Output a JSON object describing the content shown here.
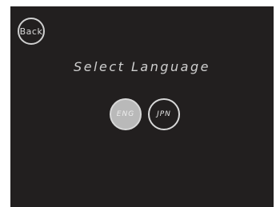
{
  "back_button": {
    "label": "Back"
  },
  "title": "Select Language",
  "languages": [
    {
      "label": "ENG",
      "selected": true
    },
    {
      "label": "JPN",
      "selected": false
    }
  ],
  "colors": {
    "screen_background": "#221f1f",
    "selected_fill": "#b9b9b9",
    "outline": "#d8d8d8"
  }
}
